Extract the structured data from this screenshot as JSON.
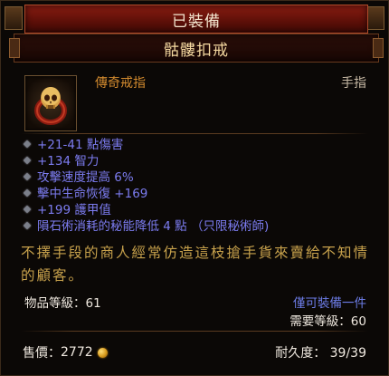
{
  "header": {
    "status": "已裝備",
    "item_name": "骷髏扣戒"
  },
  "item": {
    "icon": "skull-ring-icon",
    "type": "傳奇戒指",
    "slot": "手指"
  },
  "stats": [
    "+21-41 點傷害",
    "+134 智力",
    "攻擊速度提高 6%",
    "擊中生命恢復 +169",
    "+199 護甲值",
    "隕石術消耗的秘能降低 4 點 （只限秘術師)"
  ],
  "flavor_text": "不擇手段的商人經常仿造這枝搶手貨來賣給不知情的顧客。",
  "footer": {
    "item_level": "物品等級：61",
    "class_restriction": "僅可裝備一件",
    "required_level": "需要等級：60",
    "sell_price_label": "售價：",
    "sell_price_value": "2772",
    "durability": "耐久度： 39/39"
  },
  "colors": {
    "item_type": "#d28a2e",
    "stats": "#7c7cf0",
    "flavor": "#c8a24c",
    "class_restriction": "#6d7de8",
    "header_red": "#8a1d12"
  }
}
